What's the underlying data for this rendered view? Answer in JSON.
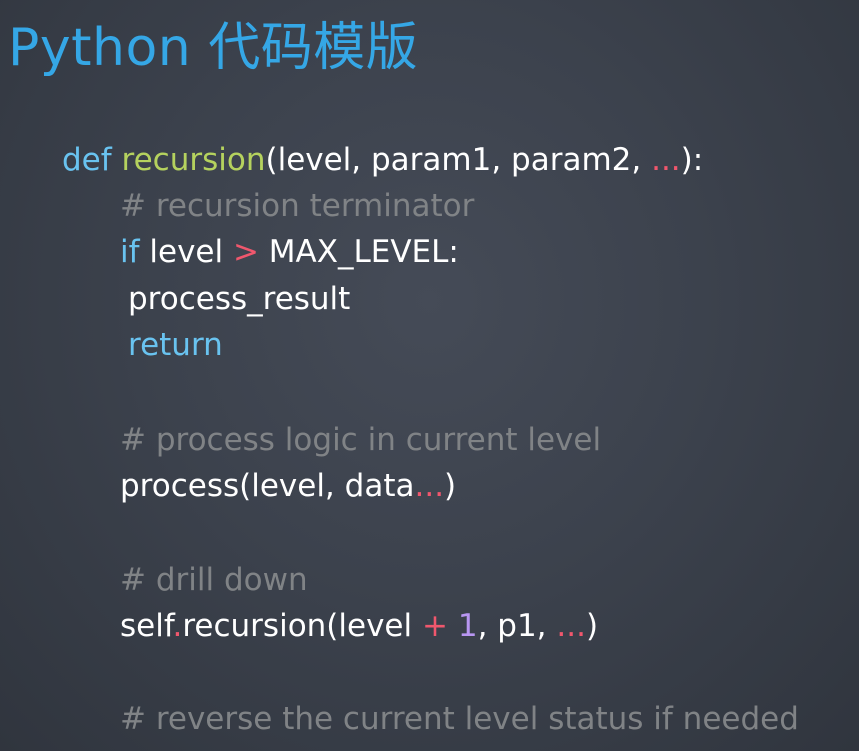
{
  "slide": {
    "title": "Python 代码模版"
  },
  "code": {
    "line1": {
      "def_kw": "def",
      "fn_name": "recursion",
      "params": "(level, param1, param2, ",
      "ellipsis": "...",
      "close": "):"
    },
    "line2": {
      "comment": "# recursion terminator"
    },
    "line3": {
      "if_kw": "if",
      "var": " level ",
      "gt": ">",
      "const": " MAX_LEVEL:"
    },
    "line4": {
      "call": "process_result"
    },
    "line5": {
      "return_kw": "return"
    },
    "line6": {
      "comment": "# process logic in current level"
    },
    "line7": {
      "call": "process(level, data",
      "ellipsis": "...",
      "close": ")"
    },
    "line8": {
      "comment": "# drill down"
    },
    "line9": {
      "self": "self",
      "dot": ".",
      "call": "recursion(level ",
      "plus": "+",
      "space": " ",
      "one": "1",
      "args": ", p1, ",
      "ellipsis": "...",
      "close": ")"
    },
    "line10": {
      "comment": "# reverse the current level status if needed"
    }
  },
  "colors": {
    "title": "#35a7e6",
    "keyword": "#69c3f0",
    "function_name": "#b5d25e",
    "operator": "#f0576d",
    "number": "#b896f2",
    "comment": "#808386",
    "text": "#ffffff",
    "background": "#3c424d"
  }
}
